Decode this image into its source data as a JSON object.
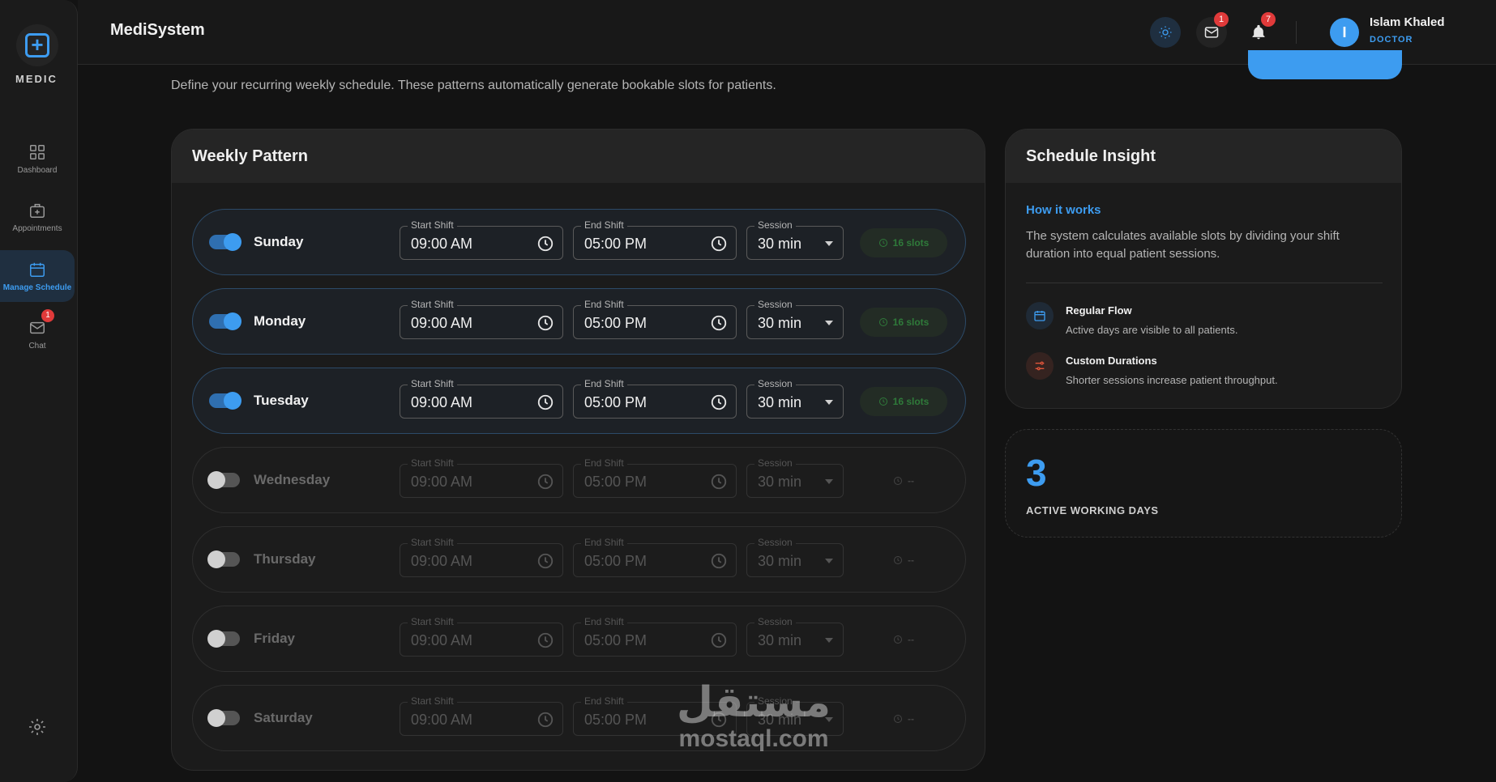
{
  "sidebar": {
    "logo_text": "MEDIC",
    "items": [
      {
        "label": "Dashboard",
        "active": false
      },
      {
        "label": "Appointments",
        "active": false
      },
      {
        "label": "Manage Schedule",
        "active": true
      },
      {
        "label": "Chat",
        "active": false,
        "badge": "1"
      }
    ]
  },
  "header": {
    "title": "MediSystem",
    "messages_badge": "1",
    "notifications_badge": "7",
    "user": {
      "initial": "I",
      "name": "Islam Khaled",
      "role": "DOCTOR"
    }
  },
  "page": {
    "subtitle": "Define your recurring weekly schedule. These patterns automatically generate bookable slots for patients."
  },
  "weekly": {
    "title": "Weekly Pattern",
    "labels": {
      "start": "Start Shift",
      "end": "End Shift",
      "session": "Session"
    },
    "days": [
      {
        "name": "Sunday",
        "enabled": true,
        "start": "09:00 AM",
        "end": "05:00 PM",
        "session": "30 min",
        "slots": "16 slots"
      },
      {
        "name": "Monday",
        "enabled": true,
        "start": "09:00 AM",
        "end": "05:00 PM",
        "session": "30 min",
        "slots": "16 slots"
      },
      {
        "name": "Tuesday",
        "enabled": true,
        "start": "09:00 AM",
        "end": "05:00 PM",
        "session": "30 min",
        "slots": "16 slots"
      },
      {
        "name": "Wednesday",
        "enabled": false,
        "start": "09:00 AM",
        "end": "05:00 PM",
        "session": "30 min",
        "slots": "--"
      },
      {
        "name": "Thursday",
        "enabled": false,
        "start": "09:00 AM",
        "end": "05:00 PM",
        "session": "30 min",
        "slots": "--"
      },
      {
        "name": "Friday",
        "enabled": false,
        "start": "09:00 AM",
        "end": "05:00 PM",
        "session": "30 min",
        "slots": "--"
      },
      {
        "name": "Saturday",
        "enabled": false,
        "start": "09:00 AM",
        "end": "05:00 PM",
        "session": "30 min",
        "slots": "--"
      }
    ]
  },
  "insight": {
    "title": "Schedule Insight",
    "how_title": "How it works",
    "how_text": "The system calculates available slots by dividing your shift duration into equal patient sessions.",
    "items": [
      {
        "title": "Regular Flow",
        "desc": "Active days are visible to all patients.",
        "icon": "calendar-icon",
        "color": "#3d9cf0"
      },
      {
        "title": "Custom Durations",
        "desc": "Shorter sessions increase patient throughput.",
        "icon": "sliders-icon",
        "color": "#e0553a"
      }
    ]
  },
  "stats": {
    "active_days": "3",
    "active_days_label": "ACTIVE WORKING DAYS"
  },
  "watermark": {
    "arabic": "مستقل",
    "latin": "mostaql.com"
  }
}
